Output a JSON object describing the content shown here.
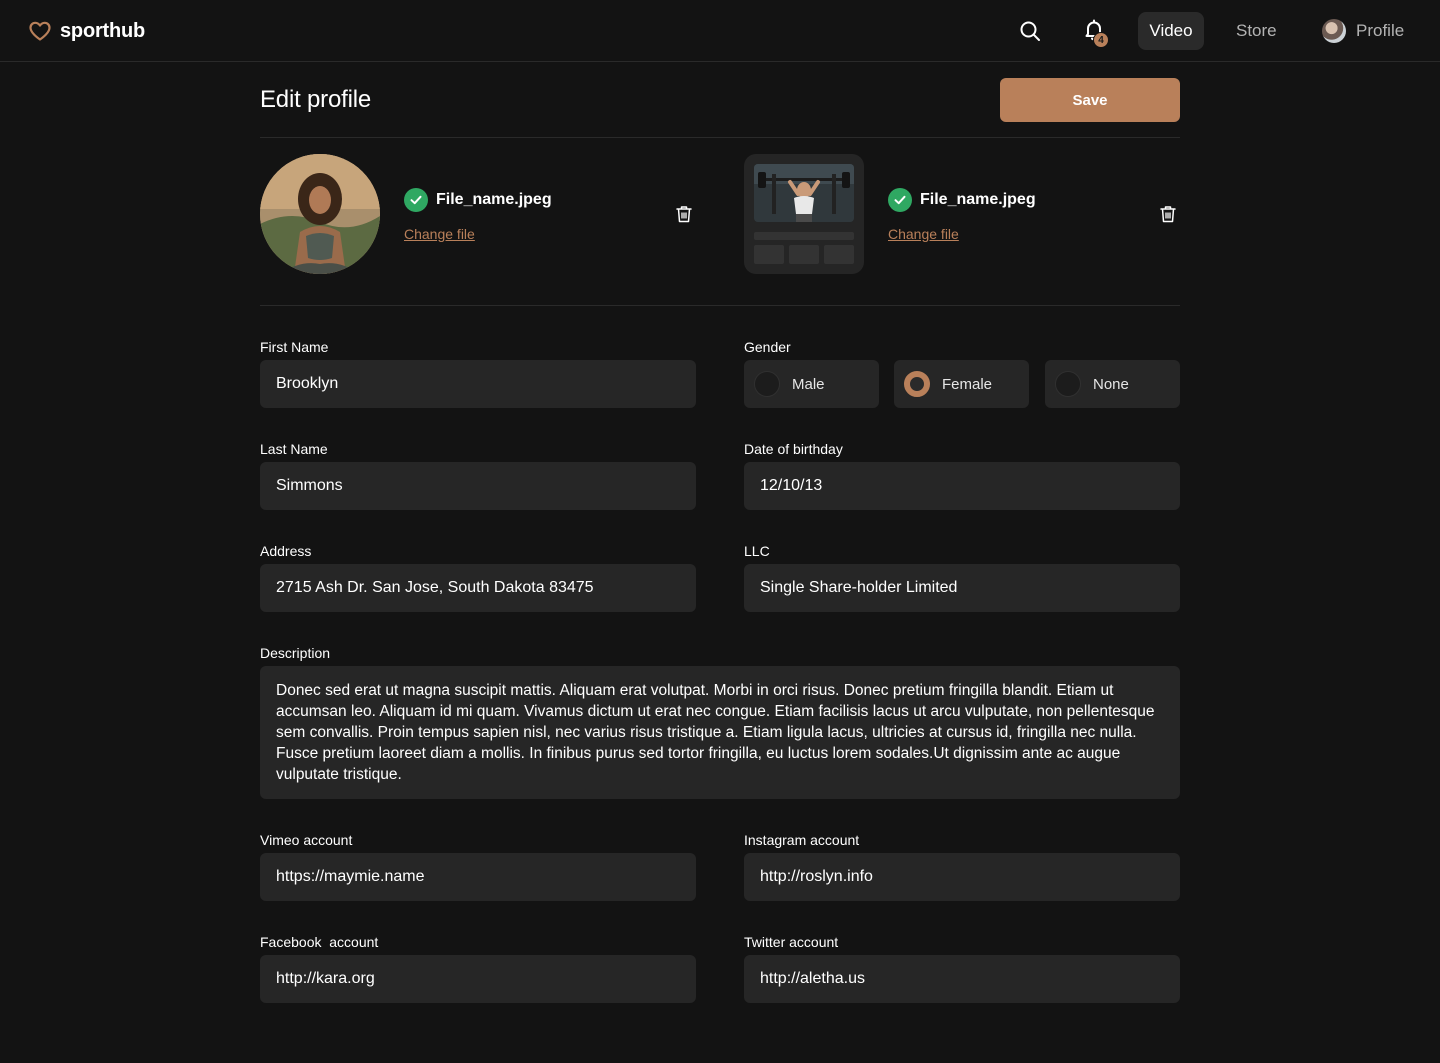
{
  "nav": {
    "brand": "sporthub",
    "notification_count": "4",
    "links": {
      "video": "Video",
      "store": "Store",
      "profile": "Profile"
    },
    "active": "Video"
  },
  "header": {
    "title": "Edit profile",
    "save_label": "Save"
  },
  "uploads": {
    "avatar": {
      "file_name": "File_name.jpeg",
      "change_label": "Change file"
    },
    "cover": {
      "file_name": "File_name.jpeg",
      "change_label": "Change file"
    }
  },
  "form": {
    "first_name": {
      "label": "First Name",
      "value": "Brooklyn"
    },
    "last_name": {
      "label": "Last Name",
      "value": "Simmons"
    },
    "address": {
      "label": "Address",
      "value": "2715 Ash Dr. San Jose, South Dakota 83475"
    },
    "gender": {
      "label": "Gender",
      "options": [
        "Male",
        "Female",
        "None"
      ],
      "selected": "Female"
    },
    "birthday": {
      "label": "Date of birthday",
      "value": "12/10/13"
    },
    "llc": {
      "label": "LLC",
      "value": "Single Share-holder Limited"
    },
    "description": {
      "label": "Description",
      "value": "Donec sed erat ut magna suscipit mattis. Aliquam erat volutpat. Morbi in orci risus. Donec pretium fringilla blandit. Etiam ut accumsan leo. Aliquam id mi quam. Vivamus dictum ut erat nec congue. Etiam facilisis lacus ut arcu vulputate, non pellentesque sem convallis. Proin tempus sapien nisl, nec varius risus tristique a. Etiam ligula lacus, ultricies at cursus id, fringilla nec nulla. Fusce pretium laoreet diam a mollis. In finibus purus sed tortor fringilla, eu luctus lorem sodales.Ut dignissim ante ac augue vulputate tristique."
    },
    "vimeo": {
      "label": "Vimeo account",
      "value": "https://maymie.name"
    },
    "instagram": {
      "label": "Instagram account",
      "value": "http://roslyn.info"
    },
    "facebook": {
      "label": "Facebook  account",
      "value": "http://kara.org"
    },
    "twitter": {
      "label": "Twitter account",
      "value": "http://aletha.us"
    }
  },
  "colors": {
    "accent": "#b9805a",
    "background": "#131313",
    "field": "#262626",
    "success": "#2fa862"
  }
}
